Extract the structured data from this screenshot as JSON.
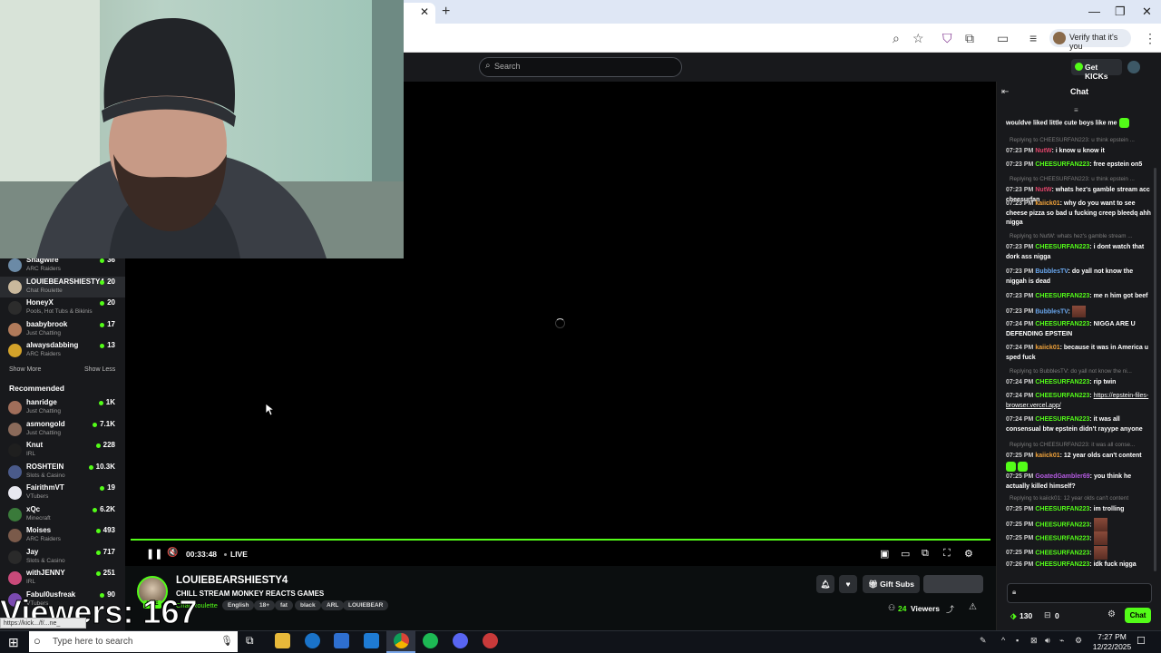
{
  "browser": {
    "tab_close": "✕",
    "new_tab": "+",
    "minimize": "—",
    "maximize": "❐",
    "close": "✕",
    "profile_chip": "Verify that it's you"
  },
  "header": {
    "search_placeholder": "Search",
    "get_kicks": "Get KICKs"
  },
  "sidebar": {
    "following": [
      {
        "name": "Snagwire",
        "category": "ARC Raiders",
        "viewers": "36",
        "color": "#6b8aa6"
      },
      {
        "name": "LOUIEBEARSHIESTY4",
        "category": "Chat Roulette",
        "viewers": "20",
        "color": "#c9b89c",
        "active": true
      },
      {
        "name": "HoneyX",
        "category": "Pools, Hot Tubs & Bikinis",
        "viewers": "20",
        "color": "#2c2c2c"
      },
      {
        "name": "baabybrook",
        "category": "Just Chatting",
        "viewers": "17",
        "color": "#b07a5a"
      },
      {
        "name": "alwaysdabbing",
        "category": "ARC Raiders",
        "viewers": "13",
        "color": "#d4a32a"
      }
    ],
    "show_more": "Show More",
    "show_less": "Show Less",
    "recommended_heading": "Recommended",
    "recommended": [
      {
        "name": "hanridge",
        "category": "Just Chatting",
        "viewers": "1K",
        "color": "#a06e5a"
      },
      {
        "name": "asmongold",
        "category": "Just Chatting",
        "viewers": "7.1K",
        "color": "#8a6a5a"
      },
      {
        "name": "Knut",
        "category": "IRL",
        "viewers": "228",
        "color": "#1f1f1f"
      },
      {
        "name": "ROSHTEIN",
        "category": "Slots & Casino",
        "viewers": "10.3K",
        "color": "#4a5a8a"
      },
      {
        "name": "FairithmVT",
        "category": "VTubers",
        "viewers": "19",
        "color": "#e8e8f0"
      },
      {
        "name": "xQc",
        "category": "Minecraft",
        "viewers": "6.2K",
        "color": "#3a7a3a"
      },
      {
        "name": "Moises",
        "category": "ARC Raiders",
        "viewers": "493",
        "color": "#7a5a4a"
      },
      {
        "name": "Jay",
        "category": "Slots & Casino",
        "viewers": "717",
        "color": "#2a2a2a"
      },
      {
        "name": "withJENNY",
        "category": "IRL",
        "viewers": "251",
        "color": "#c94a7a"
      },
      {
        "name": "Fabul0usfreak",
        "category": "VTubers",
        "viewers": "90",
        "color": "#7a4ab0"
      }
    ]
  },
  "player": {
    "time": "00:33:48",
    "live": "LIVE",
    "pause_icon": "❚❚",
    "mute_icon": "🔇",
    "clip_icon": "▣",
    "theatre_icon": "▭",
    "pip_icon": "⧉",
    "fullscreen_icon": "⛶",
    "settings_icon": "⚙"
  },
  "stream": {
    "streamer": "LOUIEBEARSHIESTY4",
    "title": "CHILL STREAM MONKEY REACTS GAMES",
    "category": "Chat Roulette",
    "live_badge": "LIVE",
    "tags": [
      "English",
      "18+",
      "fat",
      "black",
      "ARL",
      "LOUIEBEAR"
    ],
    "gift_subs": "Gift Subs",
    "viewers": "24",
    "viewers_label": "Viewers"
  },
  "overlay": {
    "viewers_text": "Viewers: 167",
    "status_url": "https://kick.../f/...ne_"
  },
  "chat": {
    "title": "Chat",
    "messages": [
      {
        "reply": "",
        "time": "",
        "user": "",
        "user_color": "#fff",
        "text": "wouldve liked little cute boys like me",
        "emote": "green"
      },
      {
        "reply": "Replying to CHEESURFAN223: u think epstein ...",
        "time": "07:23 PM",
        "user": "NutW",
        "user_color": "#e0456a",
        "text": "i know u know it"
      },
      {
        "reply": "",
        "time": "07:23 PM",
        "user": "CHEESURFAN223",
        "user_color": "#53fc18",
        "text": "free epstein on5"
      },
      {
        "reply": "Replying to CHEESURFAN223: u think epstein ...",
        "time": "07:23 PM",
        "user": "NutW",
        "user_color": "#e0456a",
        "text": "whats hez's gamble stream acc cheesurfan"
      },
      {
        "reply": "",
        "time": "07:23 PM",
        "user": "kaiick01",
        "user_color": "#f0a23a",
        "text": "why do you want to see cheese pizza so bad u fucking creep bleedq ahh nigga"
      },
      {
        "reply": "Replying to NutW: whats hez's gamble stream ...",
        "time": "07:23 PM",
        "user": "CHEESURFAN223",
        "user_color": "#53fc18",
        "text": "i dont watch that dork ass nigga"
      },
      {
        "reply": "",
        "time": "07:23 PM",
        "user": "BubblesTV",
        "user_color": "#6aa8f0",
        "text": "do yall not know the niggah is dead"
      },
      {
        "reply": "",
        "time": "07:23 PM",
        "user": "CHEESURFAN223",
        "user_color": "#53fc18",
        "text": "me n him got beef"
      },
      {
        "reply": "",
        "time": "07:23 PM",
        "user": "BubblesTV",
        "user_color": "#6aa8f0",
        "text": "",
        "emote": "image"
      },
      {
        "reply": "",
        "time": "07:24 PM",
        "user": "CHEESURFAN223",
        "user_color": "#53fc18",
        "text": "NIGGA ARE U DEFENDING EPSTEIN"
      },
      {
        "reply": "",
        "time": "07:24 PM",
        "user": "kaiick01",
        "user_color": "#f0a23a",
        "text": "because it was in America u sped fuck"
      },
      {
        "reply": "Replying to BubblesTV: do yall not know the ni...",
        "time": "07:24 PM",
        "user": "CHEESURFAN223",
        "user_color": "#53fc18",
        "text": "rip twin"
      },
      {
        "reply": "",
        "time": "07:24 PM",
        "user": "CHEESURFAN223",
        "user_color": "#53fc18",
        "text": "https://epstein-files-browser.vercel.app/",
        "link": true
      },
      {
        "reply": "",
        "time": "07:24 PM",
        "user": "CHEESURFAN223",
        "user_color": "#53fc18",
        "text": "it was all consensual btw epstein didn't rayype anyone"
      },
      {
        "reply": "Replying to CHEESURFAN223: it was all conse...",
        "time": "07:25 PM",
        "user": "kaiick01",
        "user_color": "#f0a23a",
        "text": "12 year olds can't content",
        "emote": "double-green"
      },
      {
        "reply": "",
        "time": "07:25 PM",
        "user": "GoatedGambler69",
        "user_color": "#b45ae0",
        "text": "you think he actually killed himself?"
      },
      {
        "reply": "Replying to kaiick01: 12 year olds can't content",
        "time": "07:25 PM",
        "user": "CHEESURFAN223",
        "user_color": "#53fc18",
        "text": "im trolling"
      },
      {
        "reply": "",
        "time": "07:25 PM",
        "user": "CHEESURFAN223",
        "user_color": "#53fc18",
        "text": "",
        "emote": "image"
      },
      {
        "reply": "",
        "time": "07:25 PM",
        "user": "CHEESURFAN223",
        "user_color": "#53fc18",
        "text": "",
        "emote": "image"
      },
      {
        "reply": "",
        "time": "07:25 PM",
        "user": "CHEESURFAN223",
        "user_color": "#53fc18",
        "text": "",
        "emote": "image"
      },
      {
        "reply": "",
        "time": "07:26 PM",
        "user": "CHEESURFAN223",
        "user_color": "#53fc18",
        "text": "idk fuck nigga"
      }
    ],
    "points": "130",
    "gift_count": "0",
    "send_label": "Chat"
  },
  "taskbar": {
    "search_placeholder": "Type here to search",
    "time": "7:27 PM",
    "date": "12/22/2025"
  },
  "colors": {
    "accent": "#53fc18",
    "background": "#0b0e0f",
    "panel": "#18191c"
  }
}
